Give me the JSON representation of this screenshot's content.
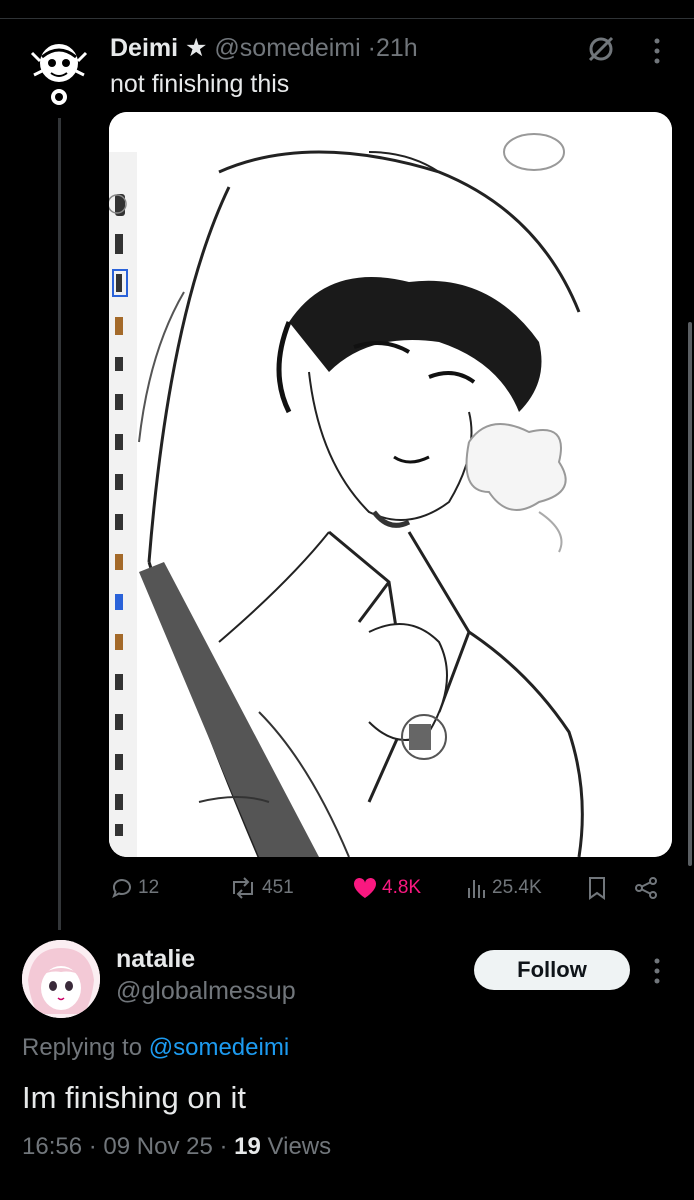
{
  "post": {
    "author_name": "Deimi",
    "author_badge": "★",
    "author_handle": "@somedeimi",
    "separator": "·",
    "time": "21h",
    "text": "not finishing this",
    "media_alt": "black and white sketch of a man in a hooded coat holding a cigarette, in a drawing app with a tool palette on the left",
    "stats": {
      "replies": "12",
      "reposts": "451",
      "likes": "4.8K",
      "views": "25.4K"
    }
  },
  "reply": {
    "author_name": "natalie",
    "author_handle": "@globalmessup",
    "follow_label": "Follow",
    "replying_prefix": "Replying to ",
    "replying_to": "@somedeimi",
    "text": "Im finishing on it",
    "time": "16:56",
    "date": "09 Nov 25",
    "views_count": "19",
    "views_label": "Views",
    "separator": "·"
  },
  "colors": {
    "background": "#000000",
    "text": "#e7e9ea",
    "muted": "#71767b",
    "like": "#f91880",
    "link": "#1d9bf0",
    "follow_bg": "#eff3f4"
  },
  "icons": [
    "grok-icon",
    "more-icon",
    "reply-icon",
    "repost-icon",
    "like-icon",
    "views-icon",
    "bookmark-icon",
    "share-icon"
  ]
}
